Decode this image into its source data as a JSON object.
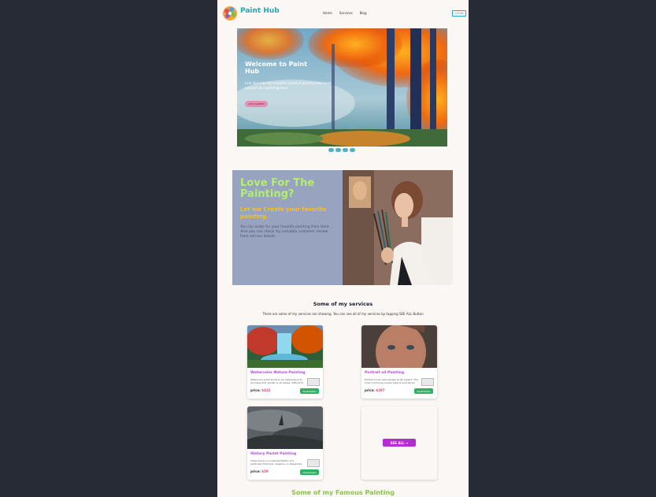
{
  "navbar": {
    "brand": "Paint Hub",
    "links": [
      "Home",
      "Services",
      "Blog"
    ],
    "login": "LOGIN"
  },
  "hero": {
    "title": "Welcome to Paint Hub",
    "subtitle": "Lets dive into the beautiful world of painting And meet yourself as a painting lover",
    "button": "GET STARTED",
    "slide_count": 4
  },
  "love": {
    "title": "Love For The Painting?",
    "subtitle": "Let me Create your favorite painting.",
    "text": "You can order for your favorite painting from Here Also you can check my valuable customer review from service details."
  },
  "services": {
    "title": "Some of my services",
    "description": "There are some of my services are showing. You can see all of my services by tapping SEE ALL Button",
    "cards": [
      {
        "title": "Watercolor Nature Painting",
        "desc": "Watercolor paint tends to be inexpensive to purchase but, similar to oil paints, difficult to",
        "price_label": "price:",
        "price": "$432",
        "button": "ViewDetails"
      },
      {
        "title": "Portrait oil Painting",
        "desc": "Portrait oil art uses people as its subject. The most commonly known type of portrait art",
        "price_label": "price:",
        "price": "$397",
        "button": "ViewDetails"
      },
      {
        "title": "History Pastel Painting",
        "desc": "These focus on a representation of a particular historical, religious, or allegorical",
        "price_label": "price:",
        "price": "$59",
        "button": "ViewDetails"
      }
    ],
    "see_all": "SEE ALL →"
  },
  "famous": {
    "title": "Some of my Famous Painting"
  },
  "colors": {
    "brand": "#25a7b3",
    "accent_purple": "#b62bd2",
    "price_pink": "#e0457a",
    "button_green": "#2bb364",
    "love_bg": "#97a3bf"
  }
}
